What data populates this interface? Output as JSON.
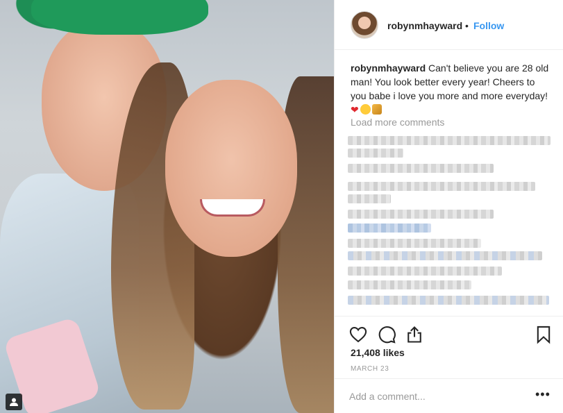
{
  "post": {
    "author": {
      "username": "robynmhayward",
      "separator": "•",
      "follow_label": "Follow"
    },
    "caption": {
      "username": "robynmhayward",
      "text": "Can't believe you are 28 old man! You look better every year! Cheers to you babe i love you more and more everyday!",
      "emojis": [
        "heart-icon",
        "kiss-face-icon",
        "cheers-icon"
      ]
    },
    "load_more_label": "Load more comments",
    "likes": "21,408 likes",
    "date": "MARCH 23",
    "comment": {
      "placeholder": "Add a comment...",
      "more_label": "•••"
    }
  },
  "icons": {
    "like": "heart-outline-icon",
    "comment": "comment-bubble-icon",
    "share": "share-icon",
    "save": "bookmark-icon",
    "user_tag": "user-tag-icon"
  },
  "colors": {
    "link_blue": "#3897f0",
    "text": "#262626",
    "muted": "#999999",
    "border": "#efefef"
  }
}
